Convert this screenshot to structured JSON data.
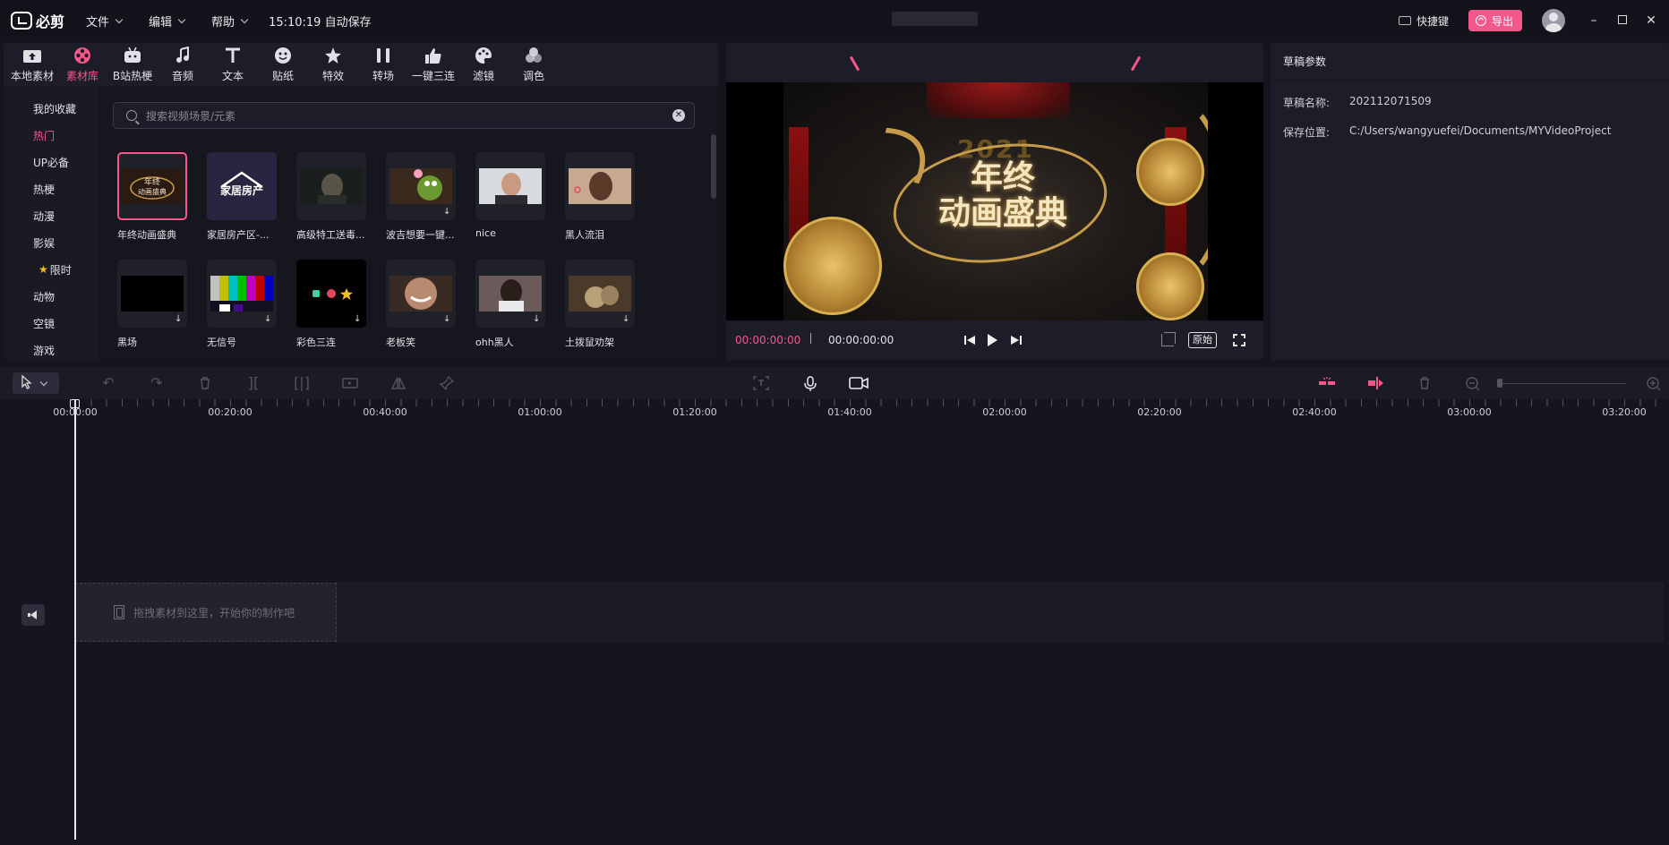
{
  "app": {
    "name": "必剪",
    "menu": [
      {
        "label": "文件"
      },
      {
        "label": "编辑"
      },
      {
        "label": "帮助"
      }
    ],
    "autosave": "15:10:19 自动保存",
    "shortcut_label": "快捷键",
    "export_label": "导出",
    "colors": {
      "accent": "#f5578b",
      "bg": "#15151f",
      "panel": "#1d1d29"
    }
  },
  "media": {
    "tabs": [
      {
        "label": "本地素材",
        "icon": "upload-folder-icon"
      },
      {
        "label": "素材库",
        "icon": "film-reel-icon",
        "active": true
      },
      {
        "label": "B站热梗",
        "icon": "bilibili-tv-icon"
      },
      {
        "label": "音频",
        "icon": "music-note-icon"
      },
      {
        "label": "文本",
        "icon": "text-t-icon"
      },
      {
        "label": "贴纸",
        "icon": "sticker-icon"
      },
      {
        "label": "特效",
        "icon": "sparkle-star-icon"
      },
      {
        "label": "转场",
        "icon": "transition-icon"
      },
      {
        "label": "一键三连",
        "icon": "thumbs-up-icon"
      },
      {
        "label": "滤镜",
        "icon": "palette-icon"
      },
      {
        "label": "调色",
        "icon": "color-circles-icon"
      }
    ],
    "categories": [
      {
        "label": "我的收藏"
      },
      {
        "label": "热门",
        "active": true
      },
      {
        "label": "UP必备"
      },
      {
        "label": "热梗"
      },
      {
        "label": "动漫"
      },
      {
        "label": "影娱"
      },
      {
        "label": "限时",
        "star": "★"
      },
      {
        "label": "动物"
      },
      {
        "label": "空镜"
      },
      {
        "label": "游戏"
      }
    ],
    "search_placeholder": "搜索视频场景/元素",
    "items": [
      {
        "label": "年终动画盛典"
      },
      {
        "label": "家居房产区-..."
      },
      {
        "label": "高级特工送毒..."
      },
      {
        "label": "波吉想要一键..."
      },
      {
        "label": "nice"
      },
      {
        "label": "黑人流泪"
      },
      {
        "label": "黑场"
      },
      {
        "label": "无信号"
      },
      {
        "label": "彩色三连"
      },
      {
        "label": "老板笑"
      },
      {
        "label": "ohh黑人"
      },
      {
        "label": "土拨鼠劝架"
      }
    ]
  },
  "preview": {
    "video_year": "2021",
    "video_title_line1": "年终",
    "video_title_line2": "动画盛典",
    "current_time": "00:00:00:00",
    "total_time": "00:00:00:00",
    "ratio_label": "原始"
  },
  "draft": {
    "header": "草稿参数",
    "name_key": "草稿名称:",
    "name_value": "202112071509",
    "path_key": "保存位置:",
    "path_value": "C:/Users/wangyuefei/Documents/MYVideoProject"
  },
  "timeline": {
    "ruler_labels": [
      "00:00:00",
      "00:20:00",
      "00:40:00",
      "01:00:00",
      "01:20:00",
      "01:40:00",
      "02:00:00",
      "02:20:00",
      "02:40:00",
      "03:00:00",
      "03:20:00"
    ],
    "drop_hint": "拖拽素材到这里，开始你的制作吧"
  }
}
